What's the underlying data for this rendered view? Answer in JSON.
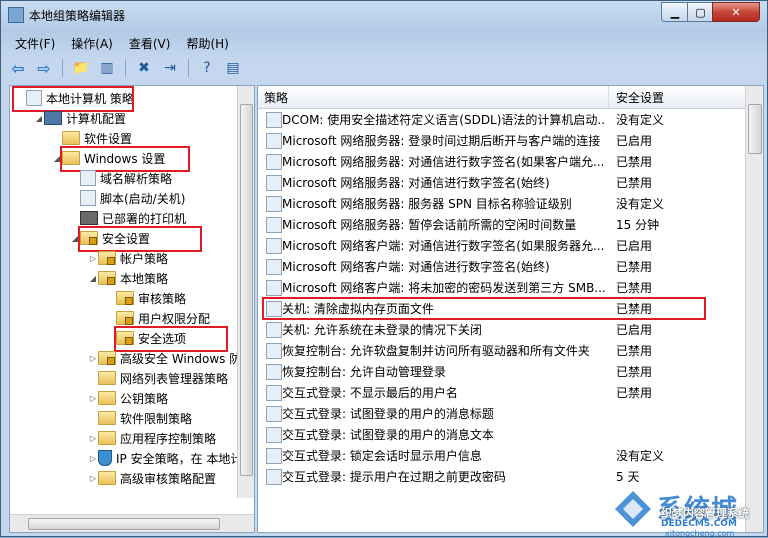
{
  "window": {
    "title": "本地组策略编辑器"
  },
  "menu": [
    "文件(F)",
    "操作(A)",
    "查看(V)",
    "帮助(H)"
  ],
  "tree": [
    {
      "label": "本地计算机 策略",
      "level": 0,
      "icon": "doc-icon",
      "arrow": "",
      "highlight": true
    },
    {
      "label": "计算机配置",
      "level": 1,
      "icon": "computer-icon",
      "arrow": "◢",
      "highlight": false
    },
    {
      "label": "软件设置",
      "level": 2,
      "icon": "folder-icon",
      "arrow": "",
      "highlight": false
    },
    {
      "label": "Windows 设置",
      "level": 2,
      "icon": "folder-icon",
      "arrow": "◢",
      "highlight": true
    },
    {
      "label": "域名解析策略",
      "level": 3,
      "icon": "doc-icon",
      "arrow": "",
      "highlight": false
    },
    {
      "label": "脚本(启动/关机)",
      "level": 3,
      "icon": "doc-icon",
      "arrow": "",
      "highlight": false
    },
    {
      "label": "已部署的打印机",
      "level": 3,
      "icon": "printer-icon",
      "arrow": "",
      "highlight": false
    },
    {
      "label": "安全设置",
      "level": 3,
      "icon": "lock-folder-icon",
      "arrow": "◢",
      "highlight": true
    },
    {
      "label": "帐户策略",
      "level": 4,
      "icon": "lock-folder-icon",
      "arrow": "▷",
      "highlight": false
    },
    {
      "label": "本地策略",
      "level": 4,
      "icon": "lock-folder-icon",
      "arrow": "◢",
      "highlight": false
    },
    {
      "label": "审核策略",
      "level": 5,
      "icon": "lock-folder-icon",
      "arrow": "",
      "highlight": false
    },
    {
      "label": "用户权限分配",
      "level": 5,
      "icon": "lock-folder-icon",
      "arrow": "",
      "highlight": false
    },
    {
      "label": "安全选项",
      "level": 5,
      "icon": "lock-folder-icon",
      "arrow": "",
      "highlight": true
    },
    {
      "label": "高级安全 Windows 防火",
      "level": 4,
      "icon": "lock-folder-icon",
      "arrow": "▷",
      "highlight": false
    },
    {
      "label": "网络列表管理器策略",
      "level": 4,
      "icon": "folder-icon",
      "arrow": "",
      "highlight": false
    },
    {
      "label": "公钥策略",
      "level": 4,
      "icon": "folder-icon",
      "arrow": "▷",
      "highlight": false
    },
    {
      "label": "软件限制策略",
      "level": 4,
      "icon": "folder-icon",
      "arrow": "",
      "highlight": false
    },
    {
      "label": "应用程序控制策略",
      "level": 4,
      "icon": "folder-icon",
      "arrow": "▷",
      "highlight": false
    },
    {
      "label": "IP 安全策略，在 本地计",
      "level": 4,
      "icon": "shield-icon",
      "arrow": "▷",
      "highlight": false
    },
    {
      "label": "高级审核策略配置",
      "level": 4,
      "icon": "folder-icon",
      "arrow": "▷",
      "highlight": false
    }
  ],
  "list": {
    "headers": {
      "policy": "策略",
      "setting": "安全设置"
    },
    "rows": [
      {
        "name": "DCOM: 使用安全描述符定义语言(SDDL)语法的计算机启动...",
        "value": "没有定义",
        "highlight": false
      },
      {
        "name": "Microsoft 网络服务器: 登录时间过期后断开与客户端的连接",
        "value": "已启用",
        "highlight": false
      },
      {
        "name": "Microsoft 网络服务器: 对通信进行数字签名(如果客户端允...",
        "value": "已禁用",
        "highlight": false
      },
      {
        "name": "Microsoft 网络服务器: 对通信进行数字签名(始终)",
        "value": "已禁用",
        "highlight": false
      },
      {
        "name": "Microsoft 网络服务器: 服务器 SPN 目标名称验证级别",
        "value": "没有定义",
        "highlight": false
      },
      {
        "name": "Microsoft 网络服务器: 暂停会话前所需的空闲时间数量",
        "value": "15 分钟",
        "highlight": false
      },
      {
        "name": "Microsoft 网络客户端: 对通信进行数字签名(如果服务器允...",
        "value": "已启用",
        "highlight": false
      },
      {
        "name": "Microsoft 网络客户端: 对通信进行数字签名(始终)",
        "value": "已禁用",
        "highlight": false
      },
      {
        "name": "Microsoft 网络客户端: 将未加密的密码发送到第三方 SMB...",
        "value": "已禁用",
        "highlight": false
      },
      {
        "name": "关机: 清除虚拟内存页面文件",
        "value": "已禁用",
        "highlight": true
      },
      {
        "name": "关机: 允许系统在未登录的情况下关闭",
        "value": "已启用",
        "highlight": false
      },
      {
        "name": "恢复控制台: 允许软盘复制并访问所有驱动器和所有文件夹",
        "value": "已禁用",
        "highlight": false
      },
      {
        "name": "恢复控制台: 允许自动管理登录",
        "value": "已禁用",
        "highlight": false
      },
      {
        "name": "交互式登录: 不显示最后的用户名",
        "value": "已禁用",
        "highlight": false
      },
      {
        "name": "交互式登录: 试图登录的用户的消息标题",
        "value": "",
        "highlight": false
      },
      {
        "name": "交互式登录: 试图登录的用户的消息文本",
        "value": "",
        "highlight": false
      },
      {
        "name": "交互式登录: 锁定会话时显示用户信息",
        "value": "没有定义",
        "highlight": false
      },
      {
        "name": "交互式登录: 提示用户在过期之前更改密码",
        "value": "5 天",
        "highlight": false
      }
    ]
  },
  "watermark": {
    "brand": "系统城",
    "line2": "织梦内容管理系统",
    "line3": "DEDECMS.COM",
    "line4": "xitongcheng.com"
  },
  "colors": {
    "highlight": "#e01b24",
    "accent": "#2f7fd1"
  }
}
